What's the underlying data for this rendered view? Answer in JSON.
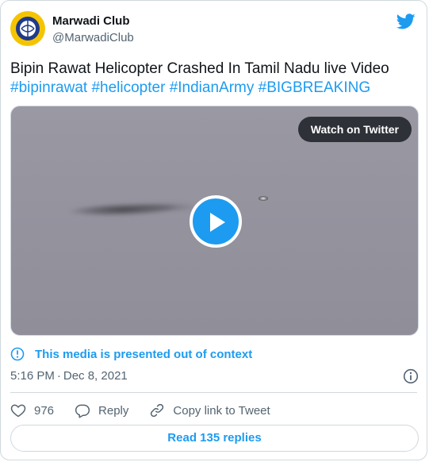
{
  "author": {
    "name": "Marwadi Club",
    "handle": "@MarwadiClub",
    "avatar_color": "#f5c400"
  },
  "tweet": {
    "text": "Bipin Rawat Helicopter Crashed In Tamil Nadu live Video",
    "hashtags": [
      "#bipinrawat",
      "#helicopter",
      "#IndianArmy",
      "#BIGBREAKING"
    ]
  },
  "media": {
    "watch_label": "Watch on Twitter",
    "play_icon": "play-icon"
  },
  "context_notice": {
    "icon": "info-icon",
    "label": "This media is presented out of context"
  },
  "timestamp": {
    "time": "5:16 PM",
    "separator": "·",
    "date": "Dec 8, 2021"
  },
  "actions": {
    "like_count": "976",
    "reply_label": "Reply",
    "copy_link_label": "Copy link to Tweet"
  },
  "read_replies_label": "Read 135 replies",
  "colors": {
    "accent": "#1d9bf0",
    "text_primary": "#0f1419",
    "text_secondary": "#536471",
    "border": "#cfd9de"
  }
}
